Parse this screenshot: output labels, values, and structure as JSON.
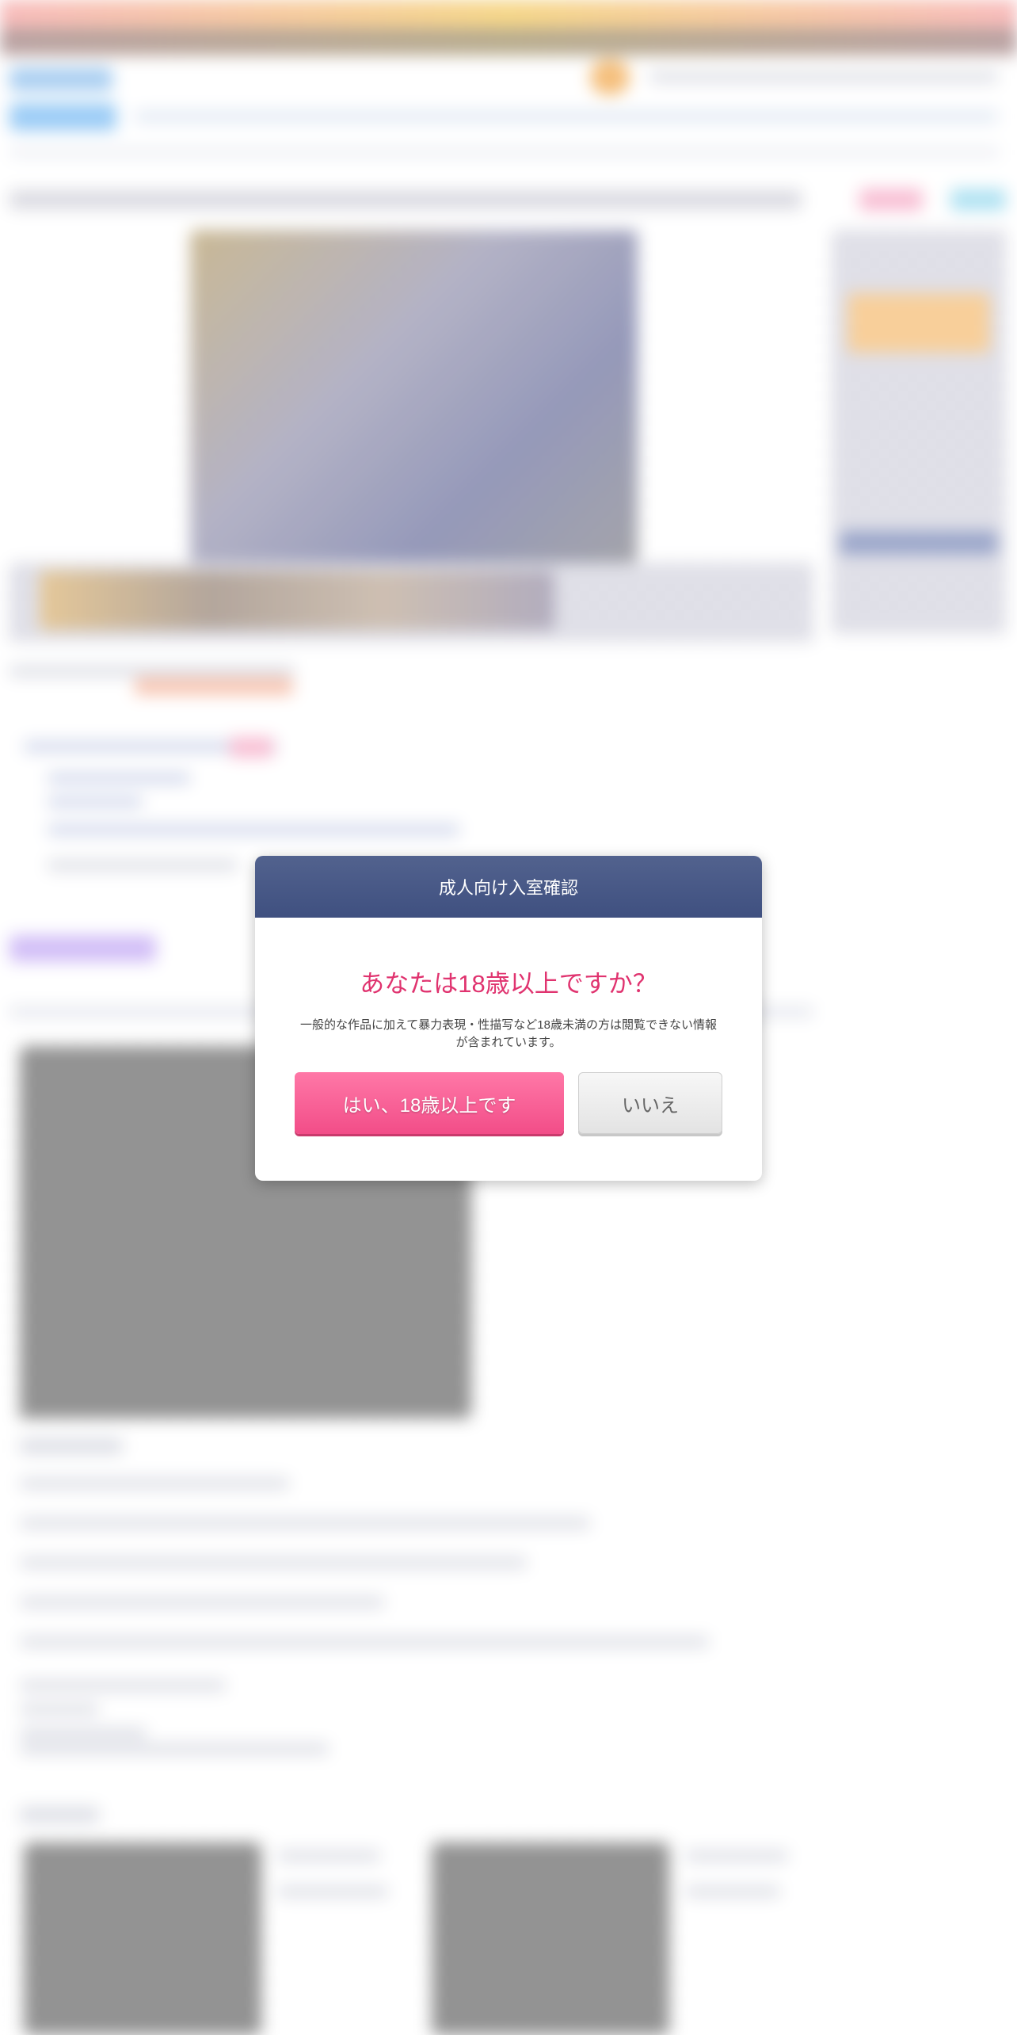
{
  "modal": {
    "title": "成人向け入室確認",
    "question": "あなたは18歳以上ですか？",
    "description": "一般的な作品に加えて暴力表現・性描写など18歳未満の方は閲覧できない情報が含まれています。",
    "yes_label": "はい、18歳以上です",
    "no_label": "いいえ"
  },
  "colors": {
    "header": "#46578a",
    "question": "#e0336f",
    "yes_button": "#f7659a",
    "no_button": "#eeeeee"
  }
}
